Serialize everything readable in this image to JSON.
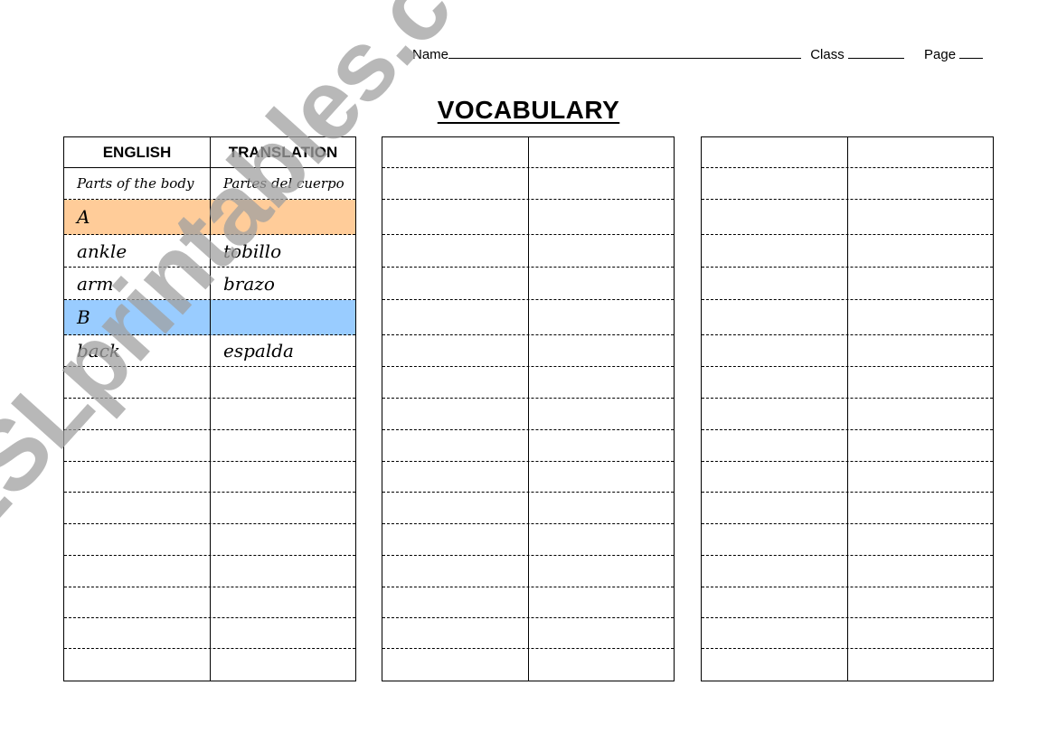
{
  "header": {
    "name_label": "Name",
    "class_label": "Class",
    "page_label": "Page"
  },
  "title": "VOCABULARY",
  "colors": {
    "section_a": "#FFCC99",
    "section_b": "#99CCFF"
  },
  "tables": [
    {
      "rows": [
        {
          "type": "header",
          "english": "ENGLISH",
          "translation": "TRANSLATION"
        },
        {
          "type": "category",
          "english": "Parts of the body",
          "translation": "Partes del cuerpo"
        },
        {
          "type": "section",
          "english": "A",
          "translation": "",
          "color": "section_a"
        },
        {
          "type": "entry",
          "english": "ankle",
          "translation": "tobillo"
        },
        {
          "type": "entry",
          "english": "arm",
          "translation": "brazo"
        },
        {
          "type": "section",
          "english": "B",
          "translation": "",
          "color": "section_b"
        },
        {
          "type": "entry",
          "english": "back",
          "translation": "espalda"
        },
        {
          "type": "entry",
          "english": "",
          "translation": ""
        },
        {
          "type": "entry",
          "english": "",
          "translation": ""
        },
        {
          "type": "entry",
          "english": "",
          "translation": ""
        },
        {
          "type": "entry",
          "english": "",
          "translation": ""
        },
        {
          "type": "entry",
          "english": "",
          "translation": ""
        },
        {
          "type": "entry",
          "english": "",
          "translation": ""
        },
        {
          "type": "entry",
          "english": "",
          "translation": ""
        },
        {
          "type": "entry",
          "english": "",
          "translation": ""
        },
        {
          "type": "entry",
          "english": "",
          "translation": ""
        },
        {
          "type": "entry",
          "english": "",
          "translation": ""
        }
      ]
    },
    {
      "rows": [
        {
          "type": "entry",
          "english": "",
          "translation": ""
        },
        {
          "type": "entry",
          "english": "",
          "translation": ""
        },
        {
          "type": "entry",
          "english": "",
          "translation": ""
        },
        {
          "type": "entry",
          "english": "",
          "translation": ""
        },
        {
          "type": "entry",
          "english": "",
          "translation": ""
        },
        {
          "type": "entry",
          "english": "",
          "translation": ""
        },
        {
          "type": "entry",
          "english": "",
          "translation": ""
        },
        {
          "type": "entry",
          "english": "",
          "translation": ""
        },
        {
          "type": "entry",
          "english": "",
          "translation": ""
        },
        {
          "type": "entry",
          "english": "",
          "translation": ""
        },
        {
          "type": "entry",
          "english": "",
          "translation": ""
        },
        {
          "type": "entry",
          "english": "",
          "translation": ""
        },
        {
          "type": "entry",
          "english": "",
          "translation": ""
        },
        {
          "type": "entry",
          "english": "",
          "translation": ""
        },
        {
          "type": "entry",
          "english": "",
          "translation": ""
        },
        {
          "type": "entry",
          "english": "",
          "translation": ""
        },
        {
          "type": "entry",
          "english": "",
          "translation": ""
        }
      ]
    },
    {
      "rows": [
        {
          "type": "entry",
          "english": "",
          "translation": ""
        },
        {
          "type": "entry",
          "english": "",
          "translation": ""
        },
        {
          "type": "entry",
          "english": "",
          "translation": ""
        },
        {
          "type": "entry",
          "english": "",
          "translation": ""
        },
        {
          "type": "entry",
          "english": "",
          "translation": ""
        },
        {
          "type": "entry",
          "english": "",
          "translation": ""
        },
        {
          "type": "entry",
          "english": "",
          "translation": ""
        },
        {
          "type": "entry",
          "english": "",
          "translation": ""
        },
        {
          "type": "entry",
          "english": "",
          "translation": ""
        },
        {
          "type": "entry",
          "english": "",
          "translation": ""
        },
        {
          "type": "entry",
          "english": "",
          "translation": ""
        },
        {
          "type": "entry",
          "english": "",
          "translation": ""
        },
        {
          "type": "entry",
          "english": "",
          "translation": ""
        },
        {
          "type": "entry",
          "english": "",
          "translation": ""
        },
        {
          "type": "entry",
          "english": "",
          "translation": ""
        },
        {
          "type": "entry",
          "english": "",
          "translation": ""
        },
        {
          "type": "entry",
          "english": "",
          "translation": ""
        }
      ]
    }
  ],
  "watermark": "ESLprintables.com"
}
